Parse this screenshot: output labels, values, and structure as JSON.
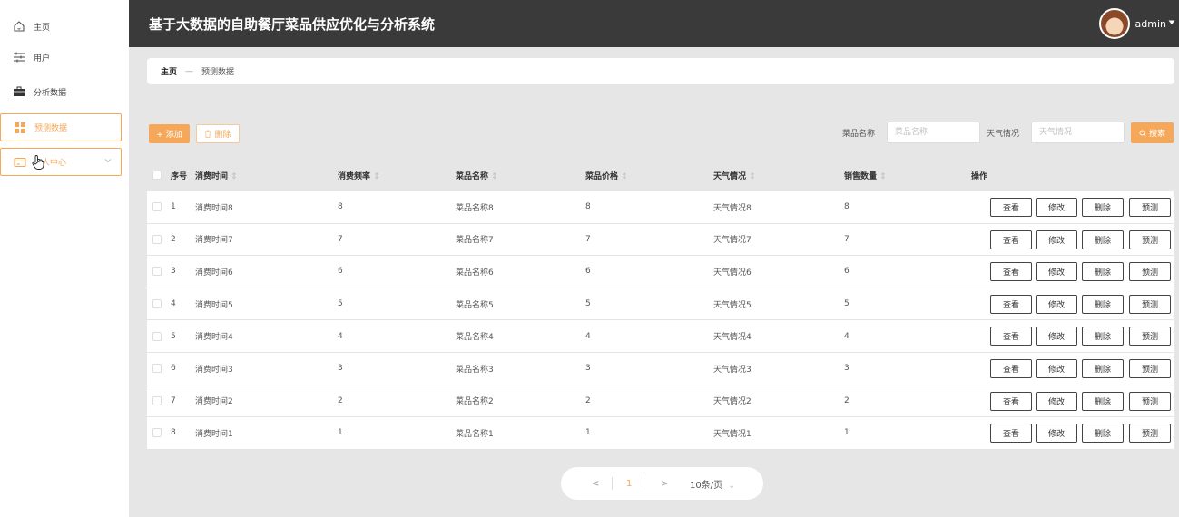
{
  "sidebar": {
    "items": [
      {
        "label": "主页",
        "icon": "home-icon"
      },
      {
        "label": "用户",
        "icon": "sliders-icon"
      },
      {
        "label": "分析数据",
        "icon": "briefcase-icon"
      },
      {
        "label": "预测数据",
        "icon": "grid-icon"
      },
      {
        "label": "人中心",
        "icon": "card-icon"
      }
    ]
  },
  "header": {
    "title": "基于大数据的自助餐厅菜品供应优化与分析系统",
    "username": "admin"
  },
  "breadcrumb": {
    "home": "主页",
    "sep": "—",
    "current": "预测数据"
  },
  "toolbar": {
    "add_label": "+ 添加",
    "delete_label": "删除",
    "dish_label": "菜品名称",
    "dish_placeholder": "菜品名称",
    "weather_label": "天气情况",
    "weather_placeholder": "天气情况",
    "search_label": "搜索"
  },
  "table": {
    "headers": [
      "序号",
      "消费时间",
      "消费频率",
      "菜品名称",
      "菜品价格",
      "天气情况",
      "销售数量",
      "操作"
    ],
    "rows": [
      [
        "1",
        "消费时间8",
        "8",
        "菜品名称8",
        "8",
        "天气情况8",
        "8"
      ],
      [
        "2",
        "消费时间7",
        "7",
        "菜品名称7",
        "7",
        "天气情况7",
        "7"
      ],
      [
        "3",
        "消费时间6",
        "6",
        "菜品名称6",
        "6",
        "天气情况6",
        "6"
      ],
      [
        "4",
        "消费时间5",
        "5",
        "菜品名称5",
        "5",
        "天气情况5",
        "5"
      ],
      [
        "5",
        "消费时间4",
        "4",
        "菜品名称4",
        "4",
        "天气情况4",
        "4"
      ],
      [
        "6",
        "消费时间3",
        "3",
        "菜品名称3",
        "3",
        "天气情况3",
        "3"
      ],
      [
        "7",
        "消费时间2",
        "2",
        "菜品名称2",
        "2",
        "天气情况2",
        "2"
      ],
      [
        "8",
        "消费时间1",
        "1",
        "菜品名称1",
        "1",
        "天气情况1",
        "1"
      ]
    ],
    "actions": [
      "查看",
      "修改",
      "删除",
      "预测"
    ]
  },
  "pagination": {
    "prev": "<",
    "page": "1",
    "next": ">",
    "page_size": "10条/页"
  },
  "colors": {
    "accent": "#f5a85a",
    "header_bg": "#3a3a3a",
    "main_bg": "#e6e6e6"
  }
}
